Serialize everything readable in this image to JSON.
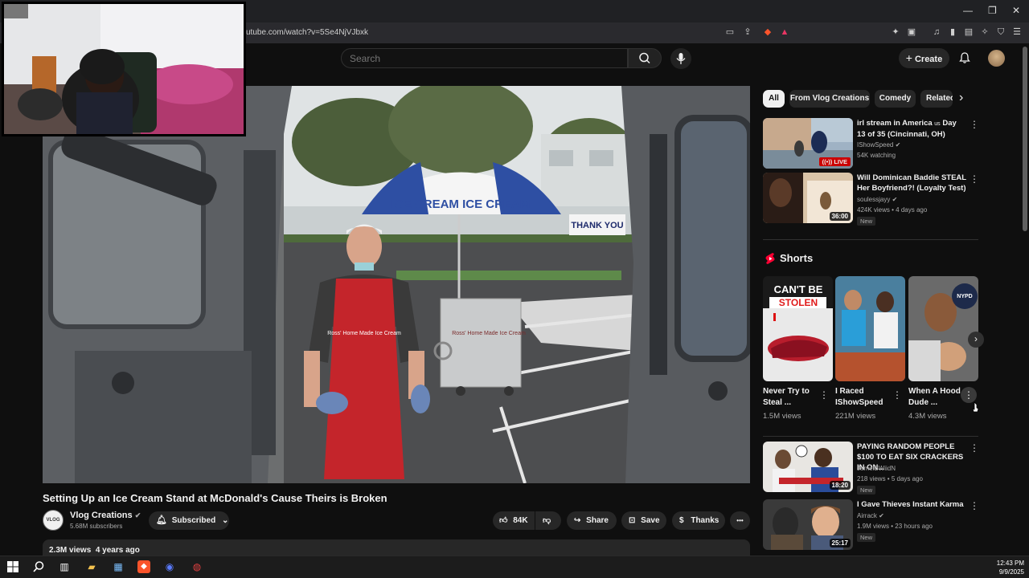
{
  "browser": {
    "url": "utube.com/watch?v=5Se4NjVJbxk",
    "window_controls": [
      "—",
      "❐",
      "✕"
    ]
  },
  "header": {
    "search_placeholder": "Search",
    "create_label": "Create",
    "plus": "+"
  },
  "video": {
    "title": "Setting Up an Ice Cream Stand at McDonald's Cause Theirs is Broken",
    "scene_text": {
      "umbrella": "ICE CREAM   ICE CREAM",
      "banner": "THANK YOU",
      "apron": "Ross' Home Made Ice Cream",
      "cart": "Ross' Home Made Ice Cream"
    },
    "channel": {
      "name": "Vlog Creations",
      "subscribers": "5.68M subscribers",
      "avatar_text": "VLOG"
    },
    "actions": {
      "subscribed": "Subscribed",
      "likes": "84K",
      "share": "Share",
      "save": "Save",
      "thanks": "Thanks",
      "more": "•••"
    },
    "description": {
      "views": "2.3M views",
      "age": "4 years ago"
    }
  },
  "sidebar": {
    "chips": [
      "All",
      "From Vlog Creations",
      "Comedy",
      "Relatec"
    ],
    "chip_next": "›",
    "recommendations_top": [
      {
        "title": "irl stream in America",
        "title_small": "us",
        "title_cont": "Day 13 of 35 (Cincinnati, OH)",
        "channel": "IShowSpeed",
        "meta": "54K watching",
        "live_label": "LIVE"
      },
      {
        "title": "Will Dominican Baddie STEAL Her Boyfriend?! (Loyalty Test)",
        "channel": "soulessjayy",
        "meta": "424K views • 4 days ago",
        "badge": "New",
        "duration": "36:00"
      }
    ],
    "shorts_heading": "Shorts",
    "shorts": [
      {
        "title": "Never Try to Steal ...",
        "views": "1.5M views",
        "thumb_text_1": "CAN'T BE",
        "thumb_text_2": "STOLEN"
      },
      {
        "title": "I Raced IShowSpeed",
        "views": "221M views"
      },
      {
        "title": "When A Hood Dude ...",
        "views": "4.3M views",
        "thumb_text_1": "NYPD"
      }
    ],
    "recommendations_bottom": [
      {
        "title": "PAYING RANDOM PEOPLE $100 TO EAT SIX CRACKERS IN ON...",
        "channel": "JamelBWiidN",
        "meta": "218 views • 5 days ago",
        "badge": "New",
        "duration": "18:20"
      },
      {
        "title": "I Gave Thieves Instant Karma",
        "channel": "Airrack",
        "meta": "1.9M views • 23 hours ago",
        "badge": "New",
        "duration": "25:17"
      }
    ]
  },
  "taskbar": {
    "time": "12:43 PM",
    "date": "9/9/2025"
  },
  "colors": {
    "background": "#0f0f0f",
    "live_red": "#cc0000",
    "shorts_red": "#ff0033",
    "pill": "#272727"
  }
}
